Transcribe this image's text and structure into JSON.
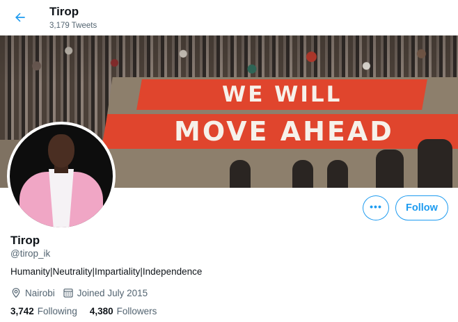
{
  "header": {
    "back_icon": "arrow-left-icon",
    "title": "Tirop",
    "tweet_count": "3,179 Tweets"
  },
  "banner": {
    "sign_line_1": "WE WILL",
    "sign_line_2": "MOVE AHEAD"
  },
  "actions": {
    "more_icon": "more-horizontal-icon",
    "more_label": "•••",
    "follow_label": "Follow"
  },
  "profile": {
    "name": "Tirop",
    "handle": "@tirop_ik",
    "bio": "Humanity|Neutrality|Impartiality|Independence",
    "location_icon": "location-pin-icon",
    "location": "Nairobi",
    "joined_icon": "calendar-icon",
    "joined": "Joined July 2015"
  },
  "stats": {
    "following_count": "3,742",
    "following_label": "Following",
    "followers_count": "4,380",
    "followers_label": "Followers"
  },
  "colors": {
    "accent": "#1d9bf0",
    "text_primary": "#0f1419",
    "text_secondary": "#536471"
  }
}
